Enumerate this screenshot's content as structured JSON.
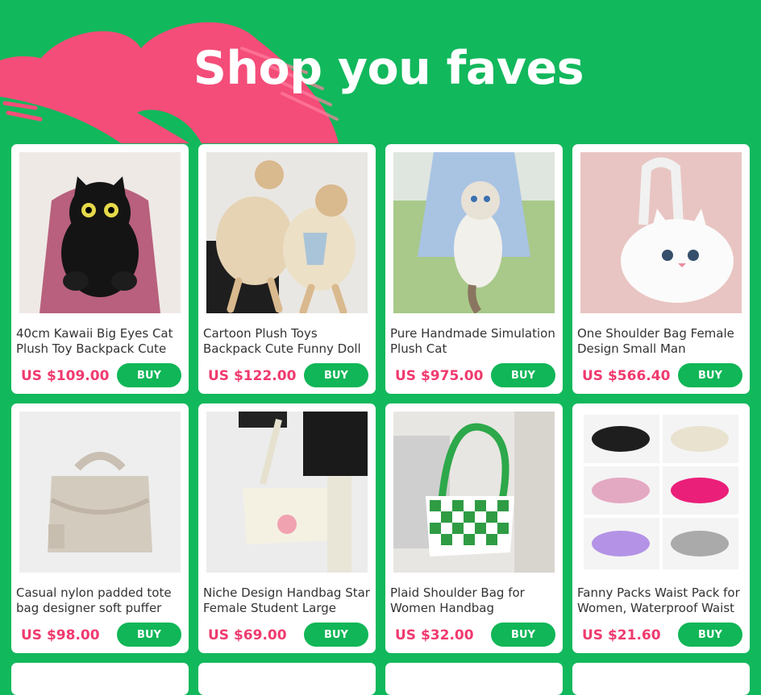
{
  "header": {
    "title": "Shop you faves"
  },
  "products": [
    {
      "name": "40cm Kawaii Big Eyes Cat Plush Toy Backpack Cute",
      "price": "US $109.00",
      "buy_label": "BUY",
      "image": "black-cat-plush-backpack"
    },
    {
      "name": "Cartoon Plush Toys Backpack Cute Funny Doll",
      "price": "US $122.00",
      "buy_label": "BUY",
      "image": "doll-plush-backpack"
    },
    {
      "name": "Pure Handmade Simulation Plush Cat",
      "price": "US $975.00",
      "buy_label": "BUY",
      "image": "white-cat-plush-bag"
    },
    {
      "name": "One Shoulder Bag Female Design Small Man",
      "price": "US $566.40",
      "buy_label": "BUY",
      "image": "white-cat-shoulder-bag"
    },
    {
      "name": "Casual nylon padded tote bag designer soft puffer",
      "price": "US $98.00",
      "buy_label": "BUY",
      "image": "padded-tote-bag"
    },
    {
      "name": "Niche Design Handbag Star Female Student Large",
      "price": "US $69.00",
      "buy_label": "BUY",
      "image": "white-star-handbag"
    },
    {
      "name": "Plaid Shoulder Bag for Women Handbag",
      "price": "US $32.00",
      "buy_label": "BUY",
      "image": "green-checkered-bag"
    },
    {
      "name": "Fanny Packs Waist Pack for Women, Waterproof Waist",
      "price": "US $21.60",
      "buy_label": "BUY",
      "image": "fanny-packs-grid"
    }
  ],
  "colors": {
    "background": "#12b85c",
    "accent_pink": "#f03a6e",
    "buy_button": "#10b657",
    "brush": "#f44d79"
  }
}
